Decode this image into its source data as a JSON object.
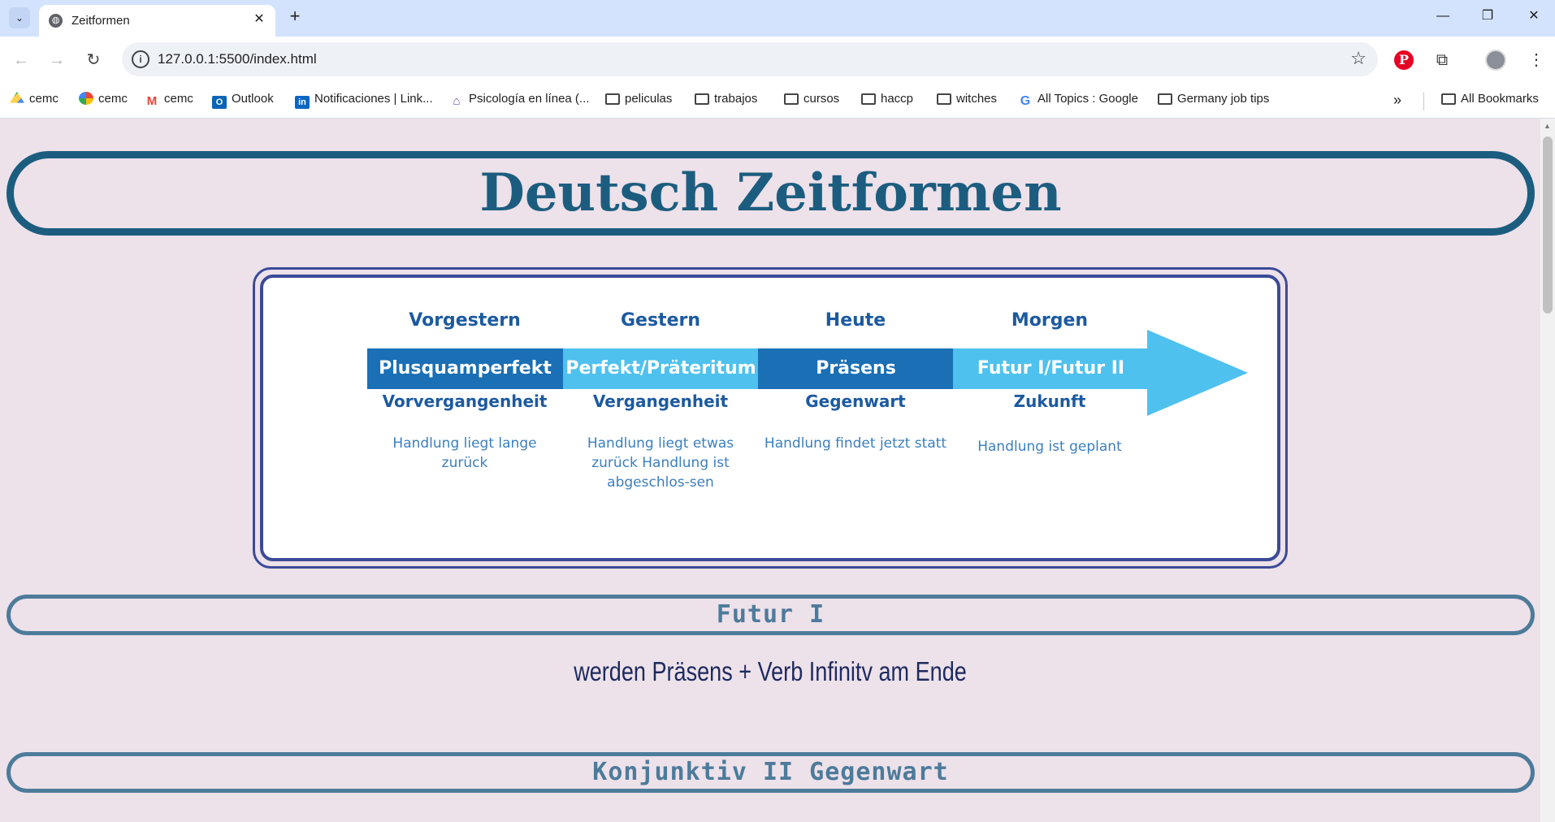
{
  "browser": {
    "tab_title": "Zeitformen",
    "url": "127.0.0.1:5500/index.html",
    "bookmarks": [
      {
        "label": "cemc",
        "icon": "drive-icon"
      },
      {
        "label": "cemc",
        "icon": "photos-icon"
      },
      {
        "label": "cemc",
        "icon": "gmail-icon"
      },
      {
        "label": "Outlook",
        "icon": "outlook-icon"
      },
      {
        "label": "Notificaciones | Link...",
        "icon": "linkedin-icon"
      },
      {
        "label": "Psicología en línea (...",
        "icon": "psychology-icon"
      },
      {
        "label": "peliculas",
        "icon": "folder-icon"
      },
      {
        "label": "trabajos",
        "icon": "folder-icon"
      },
      {
        "label": "cursos",
        "icon": "folder-icon"
      },
      {
        "label": "haccp",
        "icon": "folder-icon"
      },
      {
        "label": "witches",
        "icon": "folder-icon"
      },
      {
        "label": "All Topics : Google",
        "icon": "google-icon"
      },
      {
        "label": "Germany job tips",
        "icon": "folder-icon"
      }
    ],
    "all_bookmarks_label": "All Bookmarks"
  },
  "page": {
    "title": "Deutsch Zeitformen",
    "timeline": {
      "columns": [
        {
          "day": "Vorgestern",
          "tense": "Plusquamperfekt",
          "category": "Vorvergangenheit",
          "description": "Handlung liegt lange zurück",
          "color": "#1a6fb5"
        },
        {
          "day": "Gestern",
          "tense": "Perfekt/Präteritum",
          "category": "Vergangenheit",
          "description": "Handlung liegt etwas zurück Handlung ist abgeschlos-sen",
          "color": "#4fc1ee"
        },
        {
          "day": "Heute",
          "tense": "Präsens",
          "category": "Gegenwart",
          "description": "Handlung findet jetzt statt",
          "color": "#1a6fb5"
        },
        {
          "day": "Morgen",
          "tense": "Futur I/Futur II",
          "category": "Zukunft",
          "description": "Handlung ist geplant",
          "color": "#4fc1ee"
        }
      ]
    },
    "sections": [
      {
        "heading": "Futur I",
        "formula": "werden Präsens + Verb Infinitv am Ende"
      },
      {
        "heading": "Konjunktiv II Gegenwart",
        "formula": ""
      }
    ]
  },
  "colors": {
    "page_bg": "#ede1ea",
    "title_border": "#1c5d7f",
    "section_border": "#4d7b9a",
    "image_frame": "#3b4b98"
  }
}
